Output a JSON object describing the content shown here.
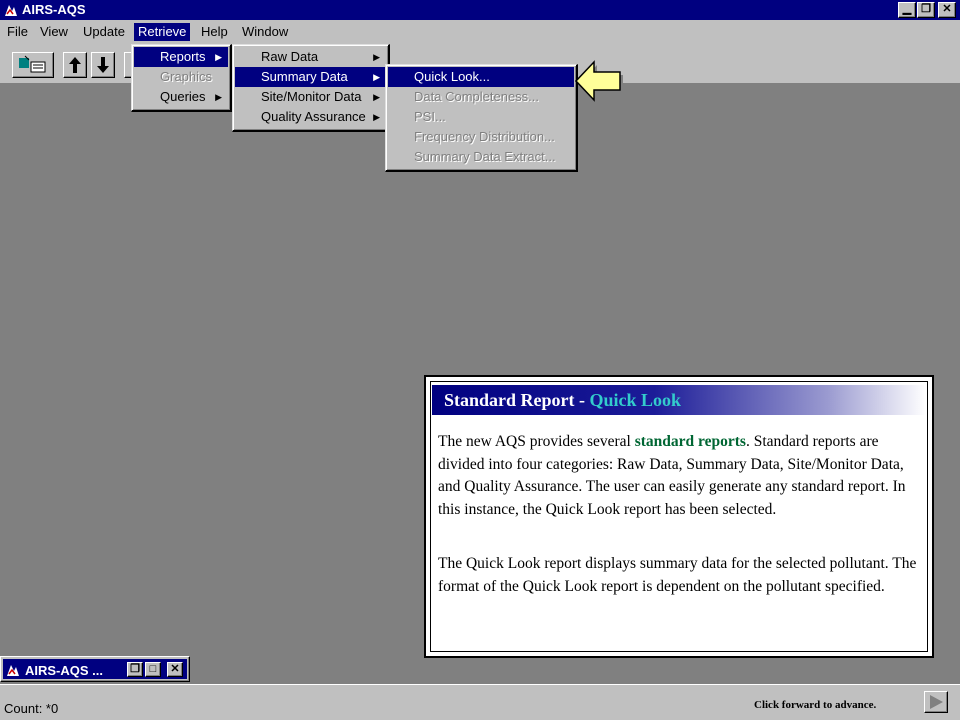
{
  "window": {
    "title": "AIRS-AQS"
  },
  "menubar": {
    "items": [
      {
        "label": "File"
      },
      {
        "label": "View"
      },
      {
        "label": "Update"
      },
      {
        "label": "Retrieve"
      },
      {
        "label": "Help"
      },
      {
        "label": "Window"
      }
    ]
  },
  "retrieve_menu": {
    "items": [
      {
        "label": "Reports"
      },
      {
        "label": "Graphics"
      },
      {
        "label": "Queries"
      }
    ]
  },
  "reports_menu": {
    "items": [
      {
        "label": "Raw Data"
      },
      {
        "label": "Summary Data"
      },
      {
        "label": "Site/Monitor Data"
      },
      {
        "label": "Quality Assurance"
      }
    ]
  },
  "summary_menu": {
    "items": [
      {
        "label": "Quick Look..."
      },
      {
        "label": "Data Completeness..."
      },
      {
        "label": "PSI..."
      },
      {
        "label": "Frequency Distribution..."
      },
      {
        "label": "Summary Data Extract..."
      }
    ]
  },
  "info_box": {
    "title_prefix": "Standard Report - ",
    "title_highlight": "Quick Look",
    "para1_start": "The new AQS provides several ",
    "para1_green": "standard reports",
    "para1_end": ".  Standard reports are divided into four categories:  Raw Data, Summary Data, Site/Monitor Data, and Quality Assurance.  The user can easily generate any standard report.  In this instance, the Quick Look report has been selected.",
    "para2": "The Quick Look report displays summary data for the selected pollutant.  The format of the Quick Look report is dependent on the pollutant specified."
  },
  "minimized_window": {
    "title": "AIRS-AQS ..."
  },
  "statusbar": {
    "count": "Count: *0",
    "advance_text": "Click forward to advance."
  },
  "colors": {
    "titlebar": "#000080",
    "face": "#c0c0c0",
    "desktop": "#808080",
    "highlight_green": "#006633",
    "highlight_teal": "#33cccc",
    "pointer_yellow": "#ffff99"
  }
}
